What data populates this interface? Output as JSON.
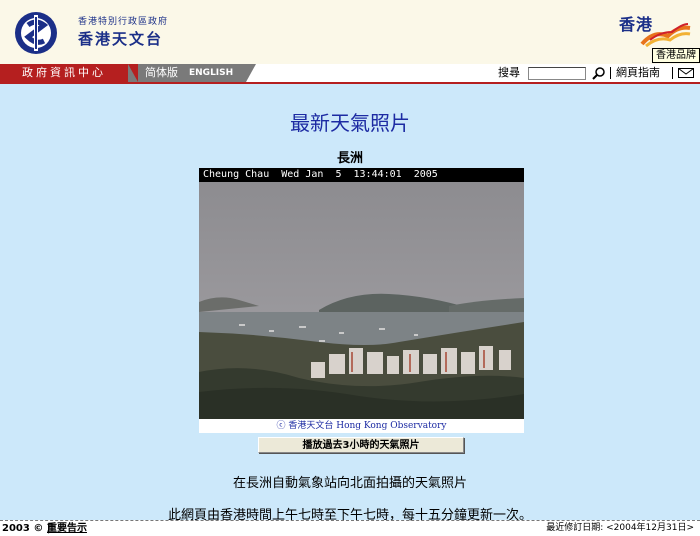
{
  "header": {
    "gov_name": "香港特別行政區政府",
    "org_name": "香港天文台",
    "brand_text": "香港",
    "brand_tooltip": "香港品牌"
  },
  "nav": {
    "gov_info": "政府資訊中心",
    "simplified": "简体版",
    "english": "ENGLISH",
    "search_label": "搜尋",
    "search_value": "",
    "sitemap": "網頁指南"
  },
  "main": {
    "title": "最新天氣照片",
    "station": "長洲",
    "camera_caption": "Cheung Chau  Wed Jan  5  13:44:01  2005",
    "credit": "ⓒ 香港天文台 Hong Kong Observatory",
    "play_button": "播放過去3小時的天氣照片",
    "description": "在長洲自動氣象站向北面拍攝的天氣照片",
    "update_note": "此網頁由香港時間上午七時至下午七時，每十五分鐘更新一次。"
  },
  "footer": {
    "year": "2003",
    "copyright_symbol": "©",
    "notice": "重要告示",
    "revision": "最近修訂日期: <2004年12月31日>"
  },
  "colors": {
    "brand_blue": "#1b2f88",
    "nav_red": "#b51f1f",
    "content_bg": "#cce8fa",
    "title_blue": "#1d2ba3"
  },
  "icons": [
    "hko-logo-icon",
    "dragon-icon",
    "search-icon",
    "mail-icon"
  ]
}
